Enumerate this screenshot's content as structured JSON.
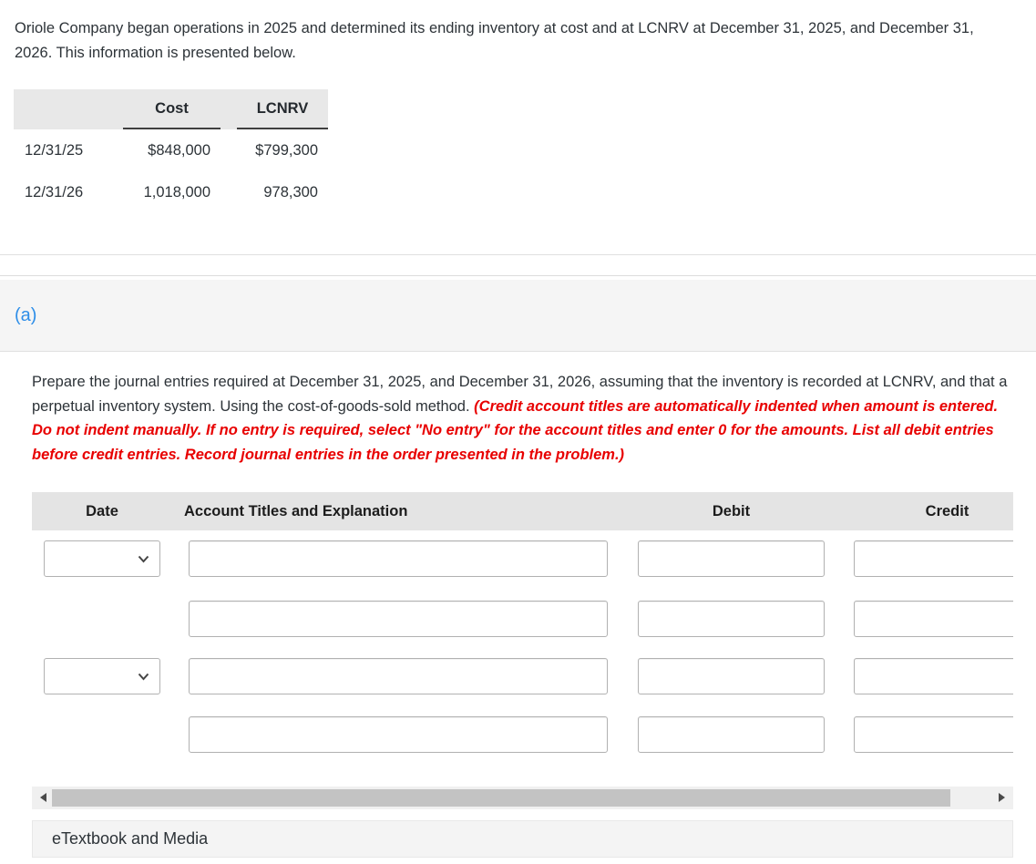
{
  "intro_text": "Oriole Company began operations in 2025 and determined its ending inventory at cost and at LCNRV at December 31, 2025, and December 31, 2026. This information is presented below.",
  "inventory_table": {
    "columns": {
      "cost": "Cost",
      "lcnrv": "LCNRV"
    },
    "rows": [
      {
        "date": "12/31/25",
        "cost": "$848,000",
        "lcnrv": "$799,300"
      },
      {
        "date": "12/31/26",
        "cost": "1,018,000",
        "lcnrv": "978,300"
      }
    ]
  },
  "section_label": "(a)",
  "instructions": {
    "normal": "Prepare the journal entries required at December 31, 2025, and December 31, 2026, assuming that the inventory is recorded at LCNRV, and that a perpetual inventory system. Using the cost-of-goods-sold method. ",
    "red": "(Credit account titles are automatically indented when amount is entered. Do not indent manually. If no entry is required, select \"No entry\" for the account titles and enter 0 for the amounts. List all debit entries before credit entries. Record journal entries in the order presented in the problem.)"
  },
  "journal_table": {
    "headers": {
      "date": "Date",
      "account": "Account Titles and Explanation",
      "debit": "Debit",
      "credit": "Credit"
    },
    "rows": [
      {
        "has_date_select": true,
        "date_value": "",
        "account_value": "",
        "debit_value": "",
        "credit_value": ""
      },
      {
        "has_date_select": false,
        "account_value": "",
        "debit_value": "",
        "credit_value": ""
      },
      {
        "has_date_select": true,
        "date_value": "",
        "account_value": "",
        "debit_value": "",
        "credit_value": ""
      },
      {
        "has_date_select": false,
        "account_value": "",
        "debit_value": "",
        "credit_value": ""
      }
    ]
  },
  "footer": {
    "etextbook_label": "eTextbook and Media"
  },
  "colors": {
    "accent_blue": "#2e8ee8",
    "alert_red": "#e80000",
    "header_gray": "#e4e4e4",
    "panel_gray": "#f5f5f5",
    "scroll_thumb": "#c3c3c3"
  }
}
